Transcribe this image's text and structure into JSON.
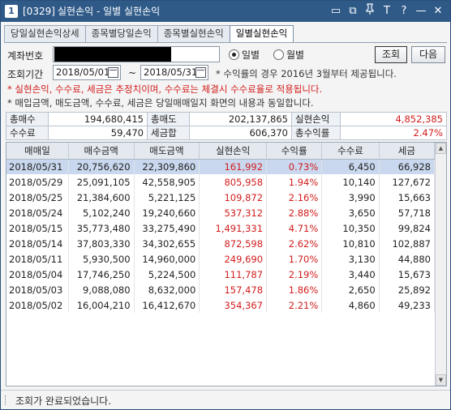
{
  "window": {
    "number": "1",
    "code": "[0329]",
    "title": "실현손익 - 일별 실현손익",
    "icons": [
      "link-icon",
      "copy-icon",
      "pin-icon",
      "font-size-icon",
      "help-icon",
      "minimize-icon",
      "close-icon"
    ],
    "icon_glyphs": [
      "▭",
      "⧉",
      "📌",
      "T",
      "?",
      "—",
      "✕"
    ]
  },
  "tabs": [
    {
      "label": "당일실현손익상세",
      "active": false
    },
    {
      "label": "종목별당일손익",
      "active": false
    },
    {
      "label": "종목별실현손익",
      "active": false
    },
    {
      "label": "일별실현손익",
      "active": true
    }
  ],
  "form": {
    "account_label": "계좌번호",
    "radio_daily": "일별",
    "radio_monthly": "월별",
    "search_button": "조회",
    "next_button": "다음",
    "period_label": "조회기간",
    "date_from": "2018/05/01",
    "date_to": "2018/05/31",
    "tilde": "~",
    "period_note": "* 수익률의 경우 2016년 3월부터 제공됩니다.",
    "notice_red": "* 실현손익, 수수료, 세금은 추정치이며, 수수료는 체결시 수수료율로 적용됩니다.",
    "notice_dark": "* 매입금액, 매도금액, 수수료, 세금은 당일매매일지 화면의 내용과 동일합니다."
  },
  "summary": {
    "total_buy_label": "총매수",
    "total_buy": "194,680,415",
    "total_sell_label": "총매도",
    "total_sell": "202,137,865",
    "realized_label": "실현손익",
    "realized": "4,852,385",
    "fee_label": "수수료",
    "fee": "59,470",
    "tax_label": "세금합",
    "tax": "606,370",
    "return_label": "총수익률",
    "return": "2.47%"
  },
  "table": {
    "headers": [
      "매매일",
      "매수금액",
      "매도금액",
      "실현손익",
      "수익률",
      "수수료",
      "세금"
    ],
    "rows": [
      [
        "2018/05/31",
        "20,756,620",
        "22,309,860",
        "161,992",
        "0.73%",
        "6,450",
        "66,928"
      ],
      [
        "2018/05/29",
        "25,091,105",
        "42,558,905",
        "805,958",
        "1.94%",
        "10,140",
        "127,672"
      ],
      [
        "2018/05/25",
        "21,384,600",
        "5,221,125",
        "109,872",
        "2.16%",
        "3,990",
        "15,663"
      ],
      [
        "2018/05/24",
        "5,102,240",
        "19,240,660",
        "537,312",
        "2.88%",
        "3,650",
        "57,718"
      ],
      [
        "2018/05/15",
        "35,773,480",
        "33,275,490",
        "1,491,331",
        "4.71%",
        "10,350",
        "99,824"
      ],
      [
        "2018/05/14",
        "37,803,330",
        "34,302,655",
        "872,598",
        "2.62%",
        "10,810",
        "102,887"
      ],
      [
        "2018/05/11",
        "5,930,500",
        "14,960,000",
        "249,690",
        "1.70%",
        "3,130",
        "44,880"
      ],
      [
        "2018/05/04",
        "17,746,250",
        "5,224,500",
        "111,787",
        "2.19%",
        "3,440",
        "15,673"
      ],
      [
        "2018/05/03",
        "9,088,080",
        "8,632,000",
        "157,478",
        "1.86%",
        "2,650",
        "25,892"
      ],
      [
        "2018/05/02",
        "16,004,210",
        "16,412,670",
        "354,367",
        "2.21%",
        "4,860",
        "49,233"
      ]
    ]
  },
  "status": {
    "message": "조회가 완료되었습니다."
  }
}
